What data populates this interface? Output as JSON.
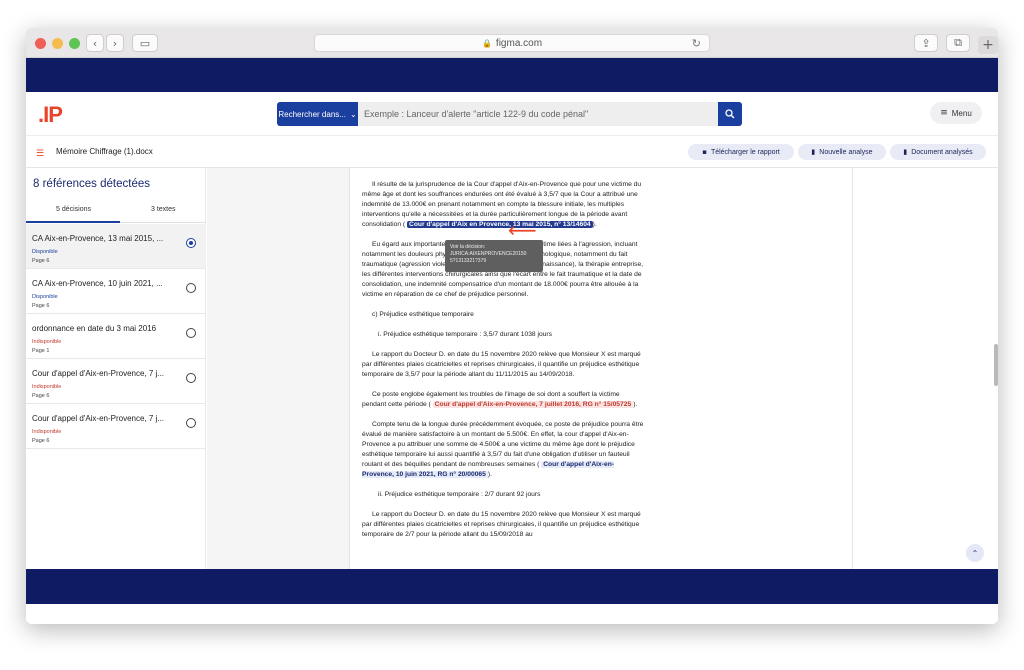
{
  "browser": {
    "url": "figma.com",
    "lock_icon": "🔒",
    "reload_icon": "↻",
    "back_icon": "‹",
    "forward_icon": "›",
    "sidebar_icon": "▭",
    "share_icon": "⇪",
    "tabs_icon": "⧉",
    "plus_icon": "+"
  },
  "header": {
    "logo_text": ".IP",
    "search_category": "Rechercher dans...",
    "search_placeholder": "Exemple : Lanceur d'alerte \"article 122-9 du code pénal\"",
    "menu_label": "Menu"
  },
  "toolbar": {
    "document_name": "Mémoire Chiffrage (1).docx",
    "download_label": "Télécharger le rapport",
    "new_analysis_label": "Nouvelle analyse",
    "analyzed_docs_label": "Document analysés"
  },
  "sidebar": {
    "title": "8 références détectées",
    "tabs": [
      {
        "label": "5 décisions",
        "active": true
      },
      {
        "label": "3 textes",
        "active": false
      }
    ],
    "references": [
      {
        "title": "CA Aix-en-Provence, 13 mai 2015, ...",
        "status": "Disponible",
        "available": true,
        "page": "Page 6",
        "selected": true
      },
      {
        "title": "CA Aix-en-Provence, 10 juin 2021, ...",
        "status": "Disponible",
        "available": true,
        "page": "Page 6",
        "selected": false
      },
      {
        "title": "ordonnance en date du 3 mai 2016",
        "status": "Indisponible",
        "available": false,
        "page": "Page 1",
        "selected": false
      },
      {
        "title": "Cour d'appel d'Aix-en-Provence, 7 j...",
        "status": "Indisponible",
        "available": false,
        "page": "Page 6",
        "selected": false
      },
      {
        "title": "Cour d'appel d'Aix-en-Provence, 7 j...",
        "status": "Indisponible",
        "available": false,
        "page": "Page 6",
        "selected": false
      }
    ]
  },
  "document": {
    "p1_pre": "Il résulte de la jurisprudence de la Cour d'appel d'Aix-en-Provence que pour une victime du même âge et dont les souffrances endurées ont été évalué à 3,5/7 que la Cour a attribué une indemnité de 13.000€ en prenant notamment en compte la blessure initiale, les multiples interventions qu'elle a nécessitées et la durée particulièrement longue de la période avant consolidation (",
    "p1_cite": "Cour d'appel d'Aix en Provence, 13 mai 2015, n° 13/14604",
    "p1_post": ").",
    "p2": "Eu égard aux importantes souffrances endurées par la victime liées à l'agression, incluant notamment les douleurs physiques et le retentissement psychologique, notamment du fait traumatique (agression violente en groupe avec perte de connaissance), la thérapie entreprise, les différentes interventions chirurgicales ainsi que l'écart entre le fait traumatique et la date de consolidation, une indemnité compensatrice d'un montant de 18.000€ pourra être allouée à la victime en réparation de ce chef de préjudice personnel.",
    "section_c": "c)  Préjudice esthétique temporaire",
    "item_i": "i.    Préjudice esthétique temporaire : 3,5/7 durant 1038 jours",
    "p3": "Le rapport du Docteur D. en date du 15 novembre 2020 relève que Monsieur X est marqué par différentes plaies cicatricielles et reprises chirurgicales, il quantifie un préjudice esthétique temporaire de 3,5/7 pour la période allant du 11/11/2015 au 14/09/2018.",
    "p4_pre": "Ce poste englobe également les troubles de l'image de soi dont a souffert la victime pendant cette période (",
    "p4_cite": "Cour d'appel d'Aix-en-Provence, 7 juillet 2016, RG n° 15/05725",
    "p4_post": ").",
    "p5_pre": "Compte tenu de la longue durée précédemment évoquée, ce poste de préjudice pourra être évalué de manière satisfactoire à un montant de 5.500€. En effet, la cour d'appel d'Aix-en-Provence a pu attribuer une somme de 4.500€ a une victime du même âge dont le préjudice esthétique temporaire lui aussi quantifié à 3,5/7 du fait d'une obligation d'utiliser un fauteuil roulant et des béquilles pendant de nombreuses semaines (",
    "p5_cite": "Cour d'appel d'Aix-en-Provence, 10 juin 2021, RG n° 20/00065",
    "p5_post": ").",
    "item_ii": "ii.    Préjudice esthétique temporaire : 2/7 durant 92 jours",
    "p6": "Le rapport du Docteur D. en date du 15 novembre 2020 relève que Monsieur X est marqué par différentes plaies cicatricielles et reprises chirurgicales, il quantifie un préjudice esthétique temporaire de 2/7 pour la période allant du 15/09/2018 au",
    "tooltip_line1": "Voir la décision:",
    "tooltip_line2": "JURICA:AIXENPROVENCE20150",
    "tooltip_line3": "5?1313321?379",
    "arrow_icon": "⟵",
    "scroll_top_icon": "⌃"
  },
  "colors": {
    "navy": "#0f1c63",
    "primary_blue": "#1b3f9f",
    "accent_red": "#e9442a"
  }
}
